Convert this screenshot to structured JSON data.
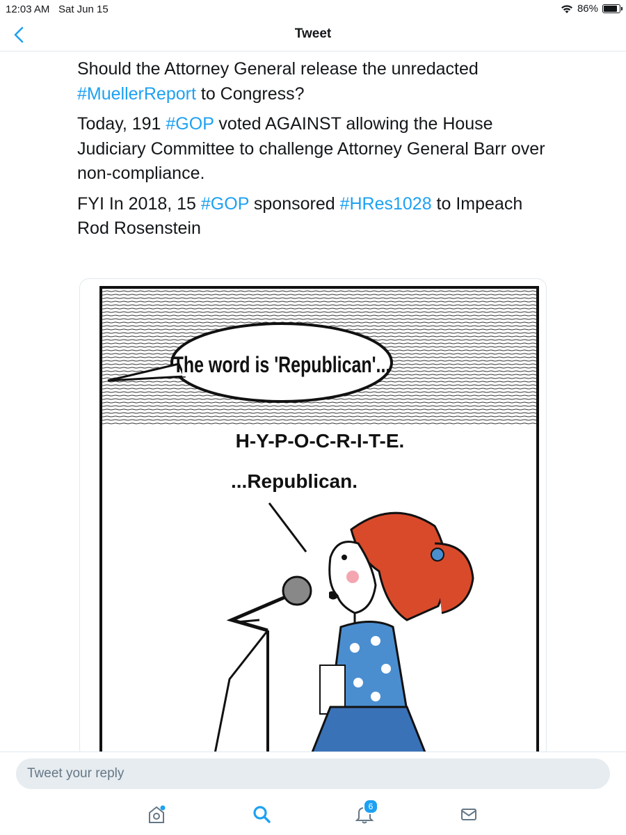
{
  "status_bar": {
    "time": "12:03 AM",
    "date": "Sat Jun 15",
    "battery": "86%",
    "battery_level": 0.86
  },
  "nav": {
    "title": "Tweet",
    "back_icon": "chevron-left-icon"
  },
  "tweet": {
    "p1": {
      "text_a": "Should the Attorney General release the unredacted ",
      "tag": "#MuellerReport",
      "text_b": " to Congress?"
    },
    "p2": {
      "text_a": "Today, 191 ",
      "tag": "#GOP",
      "text_b": " voted AGAINST allowing the House Judiciary Committee to challenge Attorney General Barr over non-compliance."
    },
    "p3": {
      "text_a": "FYI In 2018, 15 ",
      "tag1": "#GOP",
      "text_b": " sponsored ",
      "tag2": "#HRes1028",
      "text_c": " to Impeach Rod Rosenstein"
    }
  },
  "cartoon": {
    "speech": "The word is 'Republican'...",
    "line1": "H-Y-P-O-C-R-I-T-E.",
    "line2": "...Republican."
  },
  "reply": {
    "placeholder": "Tweet your reply"
  },
  "tab_bar": {
    "notifications_count": "6",
    "accent_color": "#1da1f2",
    "icons": [
      "home-icon",
      "search-icon",
      "notifications-icon",
      "messages-icon"
    ]
  }
}
